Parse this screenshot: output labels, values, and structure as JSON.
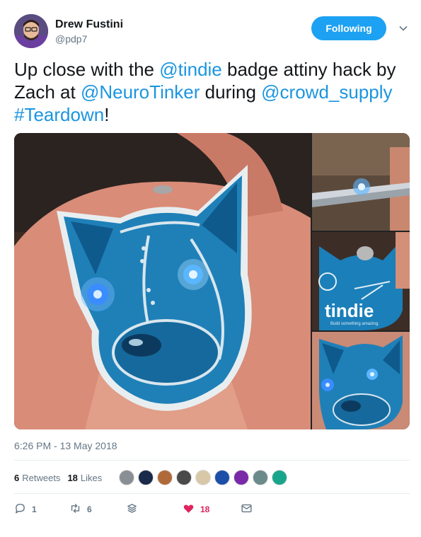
{
  "user": {
    "display_name": "Drew Fustini",
    "handle": "@pdp7",
    "follow_label": "Following"
  },
  "tweet": {
    "segments": [
      {
        "text": "Up close with the ",
        "link": false
      },
      {
        "text": "@tindie",
        "link": true
      },
      {
        "text": " badge attiny hack by Zach at ",
        "link": false
      },
      {
        "text": "@NeuroTinker",
        "link": true
      },
      {
        "text": " during ",
        "link": false
      },
      {
        "text": "@crowd_supply",
        "link": true
      },
      {
        "text": " ",
        "link": false
      },
      {
        "text": "#Teardown",
        "link": true
      },
      {
        "text": "!",
        "link": false
      }
    ]
  },
  "media": {
    "badge_text": "tindie",
    "badge_subtext": "Build something amazing."
  },
  "timestamp": "6:26 PM - 13 May 2018",
  "stats": {
    "retweets_count": "6",
    "retweets_label": "Retweets",
    "likes_count": "18",
    "likes_label": "Likes"
  },
  "actions": {
    "reply_count": "1",
    "retweet_count": "6",
    "like_count": "18"
  },
  "colors": {
    "accent": "#1da1f2",
    "link": "#1b95e0",
    "like": "#e0245e"
  }
}
